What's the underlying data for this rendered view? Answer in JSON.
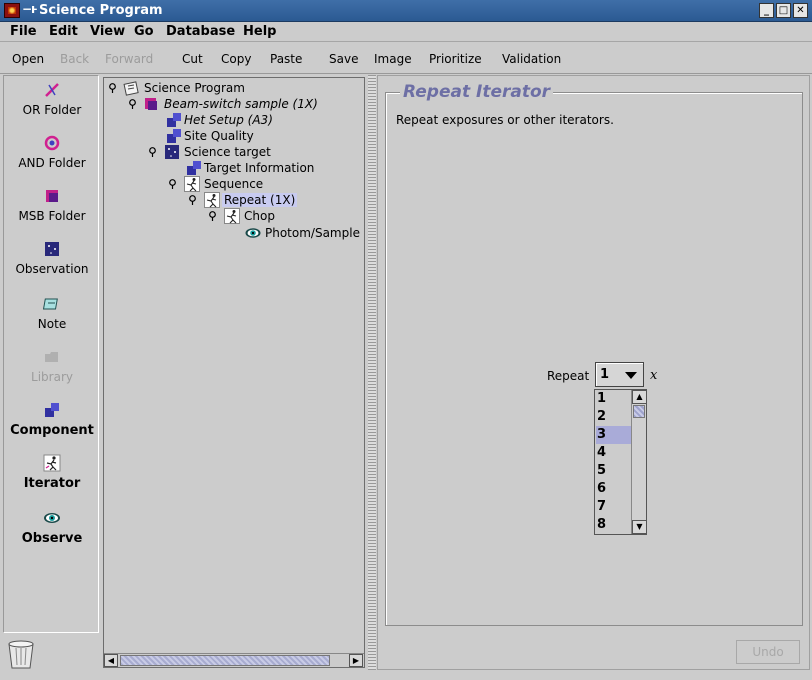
{
  "window": {
    "title": "Science Program",
    "controls": [
      "_",
      "□",
      "✕"
    ]
  },
  "menu": [
    "File",
    "Edit",
    "View",
    "Go",
    "Database",
    "Help"
  ],
  "toolbar": {
    "open": "Open",
    "back": "Back",
    "forward": "Forward",
    "cut": "Cut",
    "copy": "Copy",
    "paste": "Paste",
    "save": "Save",
    "image": "Image",
    "prioritize": "Prioritize",
    "validation": "Validation"
  },
  "palette": {
    "or_folder": "OR Folder",
    "and_folder": "AND Folder",
    "msb_folder": "MSB Folder",
    "observation": "Observation",
    "note": "Note",
    "library": "Library",
    "component": "Component",
    "iterator": "Iterator",
    "observe": "Observe"
  },
  "tree": {
    "science_program": "Science Program",
    "beam_switch": "Beam-switch sample (1X)",
    "het_setup": "Het Setup (A3)",
    "site_quality": "Site Quality",
    "science_target": "Science target",
    "target_information": "Target Information",
    "sequence": "Sequence",
    "repeat": "Repeat (1X)",
    "chop": "Chop",
    "photom": "Photom/Sample"
  },
  "editor": {
    "title": "Repeat Iterator",
    "description": "Repeat exposures or other iterators.",
    "repeat_label": "Repeat",
    "repeat_value": "1",
    "suffix": "x",
    "options": [
      "1",
      "2",
      "3",
      "4",
      "5",
      "6",
      "7",
      "8"
    ],
    "highlighted_option": "3",
    "undo_label": "Undo"
  },
  "colors": {
    "titlebar": "#2b5a92",
    "accent": "#6d6fa5",
    "selection": "#c8cbf0",
    "background": "#cccccc"
  }
}
